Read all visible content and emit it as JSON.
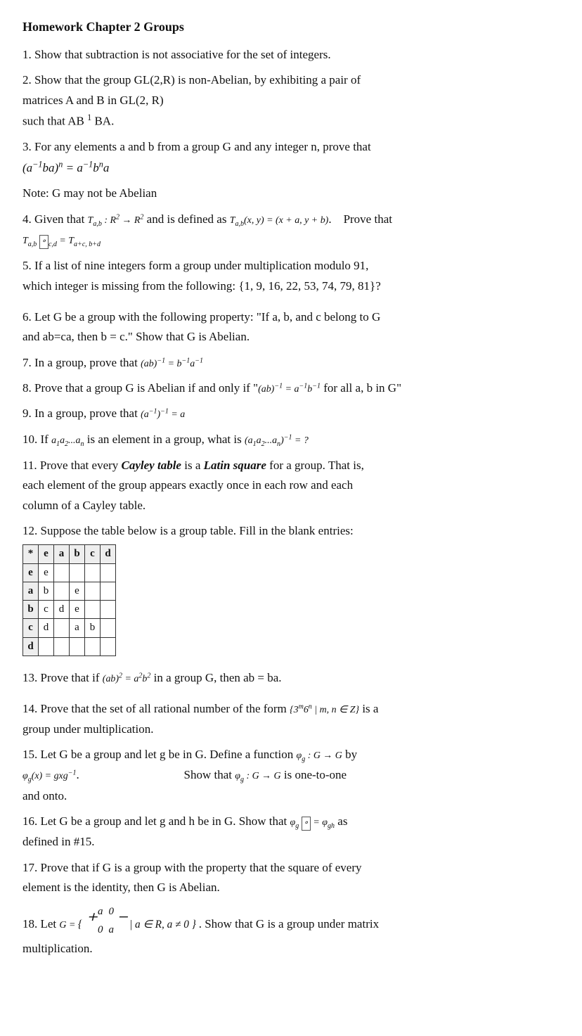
{
  "title": "Homework Chapter 2 Groups",
  "problems": [
    {
      "id": "p1",
      "number": "1.",
      "text": "Show that subtraction is not associative for the set of integers."
    },
    {
      "id": "p2",
      "number": "2.",
      "text": "Show that the group GL(2,R) is non-Abelian, by exhibiting a pair of matrices A and B in GL(2, R) such that AB"
    },
    {
      "id": "p3",
      "number": "3.",
      "text": "For any elements a and b from a group G and any integer n, prove that"
    },
    {
      "id": "p4",
      "number": "4.",
      "text": "Given that"
    },
    {
      "id": "p5",
      "number": "5.",
      "text": "If a list of nine integers form a group under multiplication modulo 91, which integer is missing from the following: {1, 9, 16, 22, 53, 74, 79, 81}?"
    },
    {
      "id": "p6",
      "number": "6.",
      "text": "Let G be a group with the following property: “If a, b, and c belong to G and ab=ca, then b = c.” Show that G is Abelian."
    },
    {
      "id": "p7",
      "number": "7.",
      "text": "In a group, prove that"
    },
    {
      "id": "p8",
      "number": "8.",
      "text": "Prove that a group G is Abelian if and only if “"
    },
    {
      "id": "p9",
      "number": "9.",
      "text": "In a group, prove that"
    },
    {
      "id": "p10",
      "number": "10.",
      "text": "If"
    },
    {
      "id": "p11",
      "number": "11.",
      "text": "Prove that every Cayley table is a Latin square for a group. That is, each element of the group appears exactly once in each row and each column of a Cayley table."
    },
    {
      "id": "p12",
      "number": "12.",
      "text": "Suppose the table below is a group table. Fill in the blank entries:"
    },
    {
      "id": "p13",
      "number": "13.",
      "text": "Prove that if"
    },
    {
      "id": "p14",
      "number": "14.",
      "text": "Prove that the set of all rational number of the form"
    },
    {
      "id": "p15",
      "number": "15.",
      "text": "Let G be a group and let g be in G. Define a function"
    },
    {
      "id": "p16",
      "number": "16.",
      "text": "Let G be a group and let g and h be in G. Show that"
    },
    {
      "id": "p17",
      "number": "17.",
      "text": "Prove that if G is a group with the property that the square of every element is the identity, then G is Abelian."
    },
    {
      "id": "p18",
      "number": "18.",
      "text": "Let"
    }
  ],
  "cayley_table": {
    "headers": [
      "*",
      "e",
      "a",
      "b",
      "c",
      "d"
    ],
    "rows": [
      [
        "e",
        "e",
        "",
        "",
        "",
        ""
      ],
      [
        "a",
        "b",
        "",
        "e",
        "",
        ""
      ],
      [
        "b",
        "c",
        "d",
        "e",
        "",
        ""
      ],
      [
        "c",
        "d",
        "",
        "a",
        "b",
        ""
      ],
      [
        "d",
        "",
        "",
        "",
        "",
        ""
      ]
    ]
  }
}
